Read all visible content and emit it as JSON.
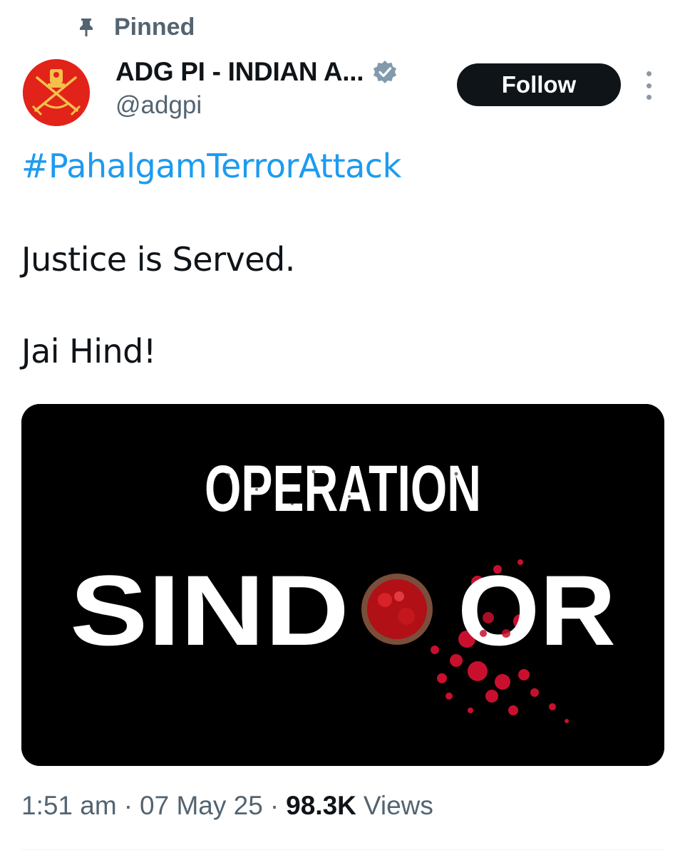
{
  "pinned": {
    "label": "Pinned",
    "icon": "pin-icon"
  },
  "author": {
    "display_name": "ADG PI - INDIAN A...",
    "handle": "@adgpi",
    "verified": true,
    "avatar_color": "#e2231a"
  },
  "follow_button": {
    "label": "Follow"
  },
  "tweet": {
    "hashtag": "#PahalgamTerrorAttack",
    "lines": [
      "Justice is Served.",
      "Jai Hind!"
    ]
  },
  "media": {
    "line1": "OPERATION",
    "line2_part1": "SIND",
    "line2_part2": "OR",
    "background": "#000000",
    "accent": "#c8102e"
  },
  "meta": {
    "time": "1:51 am",
    "date": "07 May 25",
    "views_count": "98.3K",
    "views_label": "Views",
    "separator": "·"
  },
  "colors": {
    "link": "#1d9bf0",
    "secondary_text": "#536471",
    "primary_text": "#0f1419"
  }
}
